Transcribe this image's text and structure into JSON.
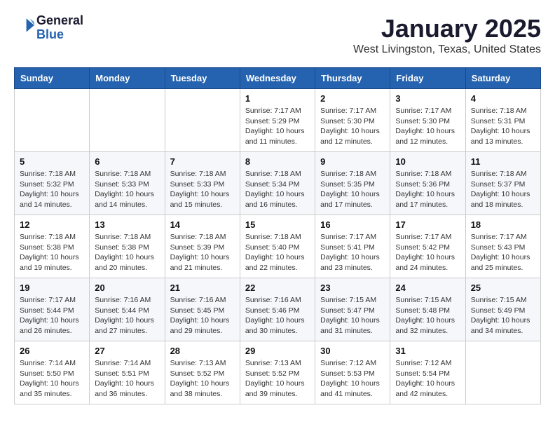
{
  "logo": {
    "line1": "General",
    "line2": "Blue"
  },
  "title": "January 2025",
  "location": "West Livingston, Texas, United States",
  "weekdays": [
    "Sunday",
    "Monday",
    "Tuesday",
    "Wednesday",
    "Thursday",
    "Friday",
    "Saturday"
  ],
  "weeks": [
    [
      {
        "day": "",
        "info": ""
      },
      {
        "day": "",
        "info": ""
      },
      {
        "day": "",
        "info": ""
      },
      {
        "day": "1",
        "info": "Sunrise: 7:17 AM\nSunset: 5:29 PM\nDaylight: 10 hours\nand 11 minutes."
      },
      {
        "day": "2",
        "info": "Sunrise: 7:17 AM\nSunset: 5:30 PM\nDaylight: 10 hours\nand 12 minutes."
      },
      {
        "day": "3",
        "info": "Sunrise: 7:17 AM\nSunset: 5:30 PM\nDaylight: 10 hours\nand 12 minutes."
      },
      {
        "day": "4",
        "info": "Sunrise: 7:18 AM\nSunset: 5:31 PM\nDaylight: 10 hours\nand 13 minutes."
      }
    ],
    [
      {
        "day": "5",
        "info": "Sunrise: 7:18 AM\nSunset: 5:32 PM\nDaylight: 10 hours\nand 14 minutes."
      },
      {
        "day": "6",
        "info": "Sunrise: 7:18 AM\nSunset: 5:33 PM\nDaylight: 10 hours\nand 14 minutes."
      },
      {
        "day": "7",
        "info": "Sunrise: 7:18 AM\nSunset: 5:33 PM\nDaylight: 10 hours\nand 15 minutes."
      },
      {
        "day": "8",
        "info": "Sunrise: 7:18 AM\nSunset: 5:34 PM\nDaylight: 10 hours\nand 16 minutes."
      },
      {
        "day": "9",
        "info": "Sunrise: 7:18 AM\nSunset: 5:35 PM\nDaylight: 10 hours\nand 17 minutes."
      },
      {
        "day": "10",
        "info": "Sunrise: 7:18 AM\nSunset: 5:36 PM\nDaylight: 10 hours\nand 17 minutes."
      },
      {
        "day": "11",
        "info": "Sunrise: 7:18 AM\nSunset: 5:37 PM\nDaylight: 10 hours\nand 18 minutes."
      }
    ],
    [
      {
        "day": "12",
        "info": "Sunrise: 7:18 AM\nSunset: 5:38 PM\nDaylight: 10 hours\nand 19 minutes."
      },
      {
        "day": "13",
        "info": "Sunrise: 7:18 AM\nSunset: 5:38 PM\nDaylight: 10 hours\nand 20 minutes."
      },
      {
        "day": "14",
        "info": "Sunrise: 7:18 AM\nSunset: 5:39 PM\nDaylight: 10 hours\nand 21 minutes."
      },
      {
        "day": "15",
        "info": "Sunrise: 7:18 AM\nSunset: 5:40 PM\nDaylight: 10 hours\nand 22 minutes."
      },
      {
        "day": "16",
        "info": "Sunrise: 7:17 AM\nSunset: 5:41 PM\nDaylight: 10 hours\nand 23 minutes."
      },
      {
        "day": "17",
        "info": "Sunrise: 7:17 AM\nSunset: 5:42 PM\nDaylight: 10 hours\nand 24 minutes."
      },
      {
        "day": "18",
        "info": "Sunrise: 7:17 AM\nSunset: 5:43 PM\nDaylight: 10 hours\nand 25 minutes."
      }
    ],
    [
      {
        "day": "19",
        "info": "Sunrise: 7:17 AM\nSunset: 5:44 PM\nDaylight: 10 hours\nand 26 minutes."
      },
      {
        "day": "20",
        "info": "Sunrise: 7:16 AM\nSunset: 5:44 PM\nDaylight: 10 hours\nand 27 minutes."
      },
      {
        "day": "21",
        "info": "Sunrise: 7:16 AM\nSunset: 5:45 PM\nDaylight: 10 hours\nand 29 minutes."
      },
      {
        "day": "22",
        "info": "Sunrise: 7:16 AM\nSunset: 5:46 PM\nDaylight: 10 hours\nand 30 minutes."
      },
      {
        "day": "23",
        "info": "Sunrise: 7:15 AM\nSunset: 5:47 PM\nDaylight: 10 hours\nand 31 minutes."
      },
      {
        "day": "24",
        "info": "Sunrise: 7:15 AM\nSunset: 5:48 PM\nDaylight: 10 hours\nand 32 minutes."
      },
      {
        "day": "25",
        "info": "Sunrise: 7:15 AM\nSunset: 5:49 PM\nDaylight: 10 hours\nand 34 minutes."
      }
    ],
    [
      {
        "day": "26",
        "info": "Sunrise: 7:14 AM\nSunset: 5:50 PM\nDaylight: 10 hours\nand 35 minutes."
      },
      {
        "day": "27",
        "info": "Sunrise: 7:14 AM\nSunset: 5:51 PM\nDaylight: 10 hours\nand 36 minutes."
      },
      {
        "day": "28",
        "info": "Sunrise: 7:13 AM\nSunset: 5:52 PM\nDaylight: 10 hours\nand 38 minutes."
      },
      {
        "day": "29",
        "info": "Sunrise: 7:13 AM\nSunset: 5:52 PM\nDaylight: 10 hours\nand 39 minutes."
      },
      {
        "day": "30",
        "info": "Sunrise: 7:12 AM\nSunset: 5:53 PM\nDaylight: 10 hours\nand 41 minutes."
      },
      {
        "day": "31",
        "info": "Sunrise: 7:12 AM\nSunset: 5:54 PM\nDaylight: 10 hours\nand 42 minutes."
      },
      {
        "day": "",
        "info": ""
      }
    ]
  ]
}
